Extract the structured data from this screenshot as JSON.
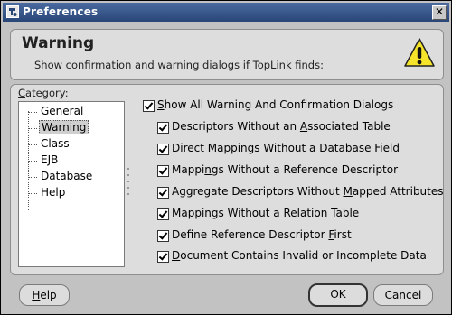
{
  "window": {
    "title": "Preferences",
    "close_glyph": "✕"
  },
  "header": {
    "title": "Warning",
    "description": "Show confirmation and warning dialogs if TopLink finds:",
    "icon": "warning-icon"
  },
  "category": {
    "label_prefix": "",
    "label_mnemonic": "C",
    "label_rest": "ategory:",
    "items": [
      {
        "label": "General",
        "selected": false
      },
      {
        "label": "Warning",
        "selected": true
      },
      {
        "label": "Class",
        "selected": false
      },
      {
        "label": "EJB",
        "selected": false
      },
      {
        "label": "Database",
        "selected": false
      },
      {
        "label": "Help",
        "selected": false
      }
    ]
  },
  "options": [
    {
      "pre": "",
      "mn": "S",
      "post": "how All Warning And Confirmation Dialogs",
      "checked": true
    },
    {
      "pre": "Descriptors Without an ",
      "mn": "A",
      "post": "ssociated Table",
      "checked": true
    },
    {
      "pre": "",
      "mn": "D",
      "post": "irect Mappings Without a Database Field",
      "checked": true
    },
    {
      "pre": "Mappi",
      "mn": "n",
      "post": "gs Without a Reference Descriptor",
      "checked": true
    },
    {
      "pre": "Aggregate Descriptors Without ",
      "mn": "M",
      "post": "apped Attributes",
      "checked": true
    },
    {
      "pre": "Mappings Without a ",
      "mn": "R",
      "post": "elation Table",
      "checked": true
    },
    {
      "pre": "Define Reference Descriptor ",
      "mn": "F",
      "post": "irst",
      "checked": true
    },
    {
      "pre": "",
      "mn": "D",
      "post": "ocument Contains Invalid or Incomplete Data",
      "checked": true
    }
  ],
  "buttons": {
    "help_mn": "H",
    "help_rest": "elp",
    "ok": "OK",
    "cancel": "Cancel"
  }
}
